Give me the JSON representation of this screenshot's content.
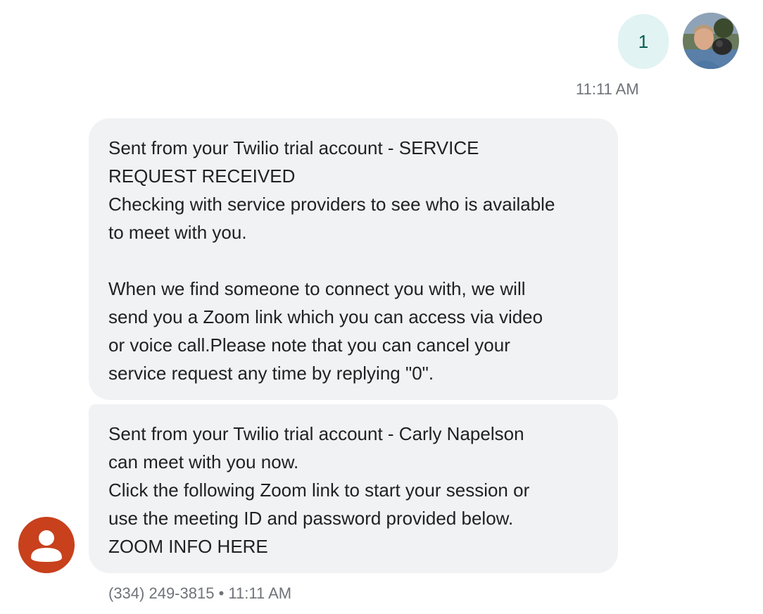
{
  "outgoing": {
    "message_text": "1",
    "timestamp": "11:11 AM",
    "bubble_color": "#e1f3f2",
    "avatar_icon": "user-photo-avatar"
  },
  "incoming": {
    "messages": [
      {
        "lines": [
          "Sent from your Twilio trial account - SERVICE",
          "REQUEST RECEIVED",
          "Checking with service providers to see who is available",
          "to meet with you.",
          "",
          "When we find someone to connect you with, we will",
          "send you a Zoom link which you can access via video",
          "or voice call.Please note that you can cancel your",
          "service request any time by replying \"0\"."
        ]
      },
      {
        "lines": [
          "Sent from your Twilio trial account - Carly Napelson",
          "can meet with you now.",
          "Click the following Zoom link to start your session or",
          "use the meeting ID and password provided below.",
          "ZOOM INFO HERE"
        ]
      }
    ],
    "sender_phone": "(334) 249-3815",
    "separator": "•",
    "timestamp": "11:11 AM",
    "bubble_color": "#f1f2f4",
    "avatar_icon": "person-icon",
    "avatar_color": "#c8401c"
  }
}
